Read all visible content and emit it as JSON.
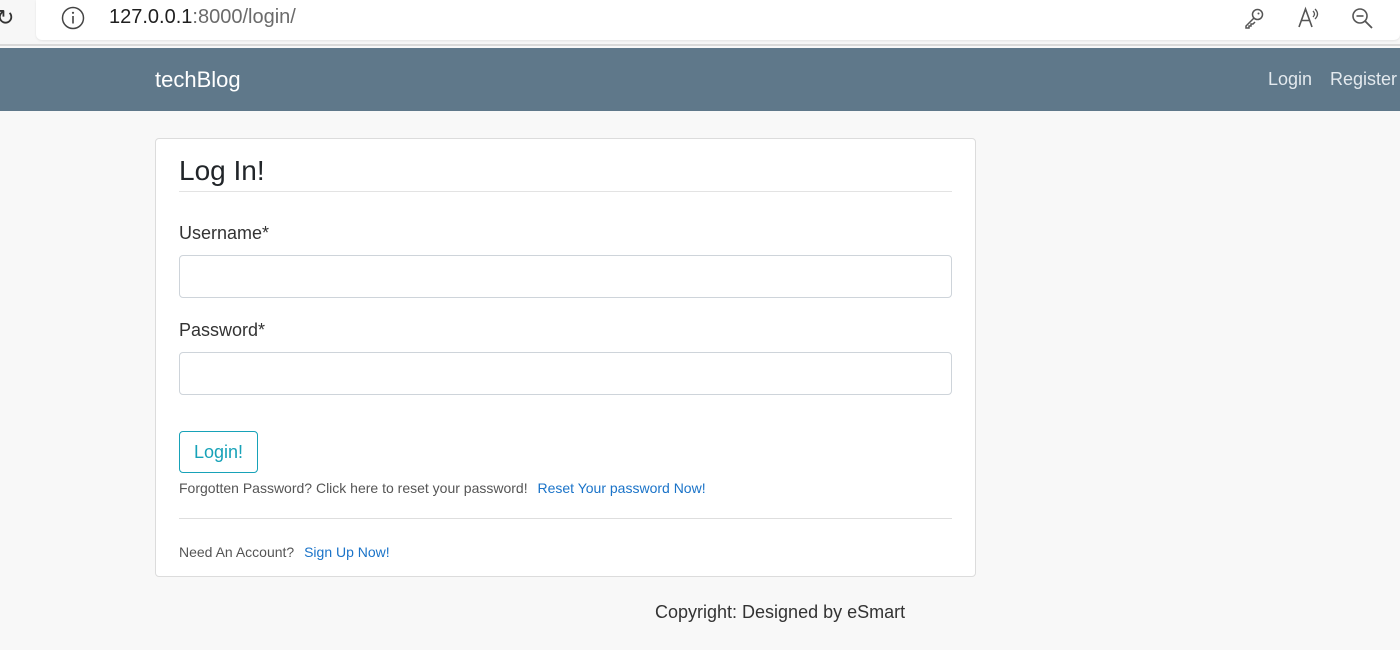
{
  "browser": {
    "reload_glyph": "↻",
    "url_host": "127.0.0.1",
    "url_rest": ":8000/login/",
    "icons": [
      "info-icon",
      "key-icon",
      "read-aloud-icon",
      "zoom-out-icon"
    ]
  },
  "navbar": {
    "brand": "techBlog",
    "links": [
      "Login",
      "Register"
    ],
    "background": "#5f788a"
  },
  "form": {
    "title": "Log In!",
    "username_label": "Username*",
    "username_value": "",
    "password_label": "Password*",
    "password_value": "",
    "submit_label": "Login!",
    "forgot_text": "Forgotten Password? Click here to reset your password!",
    "forgot_link": "Reset Your password Now!",
    "account_text": "Need An Account?",
    "signup_link": "Sign Up Now!"
  },
  "footer": {
    "text": "Copyright: Designed by eSmart"
  },
  "colors": {
    "accent": "#17a2b8",
    "link": "#1a73c8",
    "page_background": "#f8f8f8"
  }
}
